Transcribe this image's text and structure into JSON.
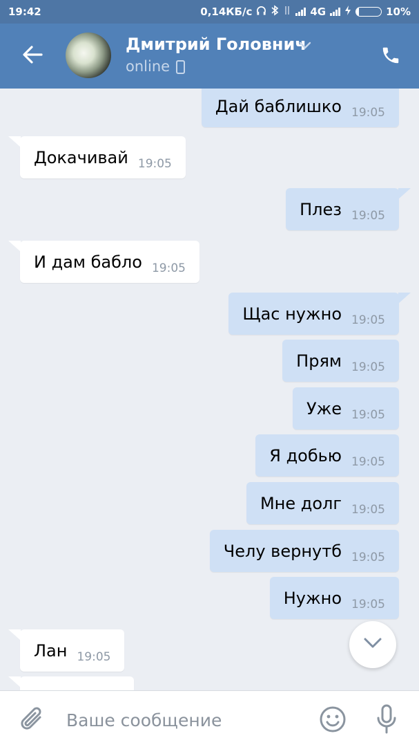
{
  "status_bar": {
    "time": "19:42",
    "net_speed": "0,14КБ/с",
    "network_type": "4G",
    "battery_percent": "10%",
    "battery_level": 0.1,
    "icons": [
      "headphones-icon",
      "bluetooth-icon",
      "signal-icon",
      "charging-icon",
      "battery-icon"
    ]
  },
  "header": {
    "contact_name": "Дмитрий Головнич",
    "status": "online",
    "icons": [
      "back-arrow-icon",
      "chevron-down-icon",
      "mobile-device-icon",
      "phone-icon"
    ]
  },
  "messages": [
    {
      "dir": "out",
      "text": "Дай баблишко",
      "time": "19:05"
    },
    {
      "dir": "in",
      "text": "Докачивай",
      "time": "19:05"
    },
    {
      "dir": "out",
      "text": "Плез",
      "time": "19:05"
    },
    {
      "dir": "in",
      "text": "И дам бабло",
      "time": "19:05"
    },
    {
      "dir": "out",
      "text": "Щас нужно",
      "time": "19:05"
    },
    {
      "dir": "out",
      "text": "Прям",
      "time": "19:05"
    },
    {
      "dir": "out",
      "text": "Уже",
      "time": "19:05"
    },
    {
      "dir": "out",
      "text": "Я добью",
      "time": "19:05"
    },
    {
      "dir": "out",
      "text": "Мне долг",
      "time": "19:05"
    },
    {
      "dir": "out",
      "text": "Челу вернутб",
      "time": "19:05"
    },
    {
      "dir": "out",
      "text": "Нужно",
      "time": "19:05"
    },
    {
      "dir": "in",
      "text": "Лан",
      "time": "19:05"
    },
    {
      "dir": "in",
      "text": "",
      "time": ""
    }
  ],
  "composer": {
    "placeholder": "Ваше сообщение",
    "value": "",
    "icons": [
      "paperclip-icon",
      "emoji-icon",
      "microphone-icon"
    ]
  },
  "colors": {
    "header_bg": "#5181b8",
    "status_bar_bg": "#4e76a5",
    "chat_bg": "#ebeef3",
    "outgoing_bubble": "#cfe0f5",
    "incoming_bubble": "#ffffff",
    "timestamp": "#8e99a6"
  }
}
